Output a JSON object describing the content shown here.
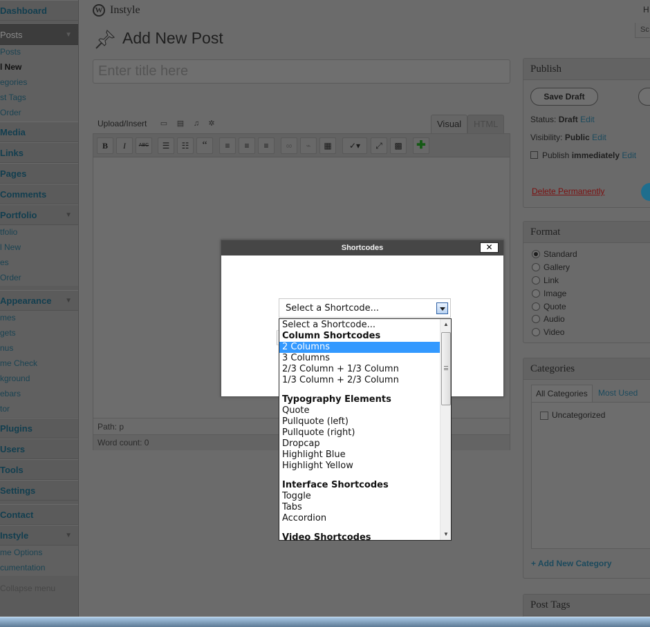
{
  "header": {
    "site_name": "Instyle",
    "howdy": "H",
    "screen_options": "Sc",
    "page_title": "Add New Post"
  },
  "sidebar": {
    "menus": [
      {
        "label": "Dashboard"
      },
      {
        "label": "Posts",
        "current": true
      },
      {
        "label": "Media"
      },
      {
        "label": "Links"
      },
      {
        "label": "Pages"
      },
      {
        "label": "Comments"
      },
      {
        "label": "Portfolio"
      },
      {
        "label": "Appearance"
      },
      {
        "label": "Plugins"
      },
      {
        "label": "Users"
      },
      {
        "label": "Tools"
      },
      {
        "label": "Settings"
      },
      {
        "label": "Contact"
      },
      {
        "label": "Instyle"
      }
    ],
    "posts_sub": [
      "Posts",
      "l New",
      "egories",
      "st Tags",
      "Order"
    ],
    "portfolio_sub": [
      "tfolio",
      "l New",
      "es",
      "Order"
    ],
    "appearance_sub": [
      "mes",
      "gets",
      "nus",
      "me Check",
      "kground",
      "ebars",
      "tor"
    ],
    "instyle_sub": [
      "me Options",
      "cumentation"
    ],
    "collapse": "Collapse menu"
  },
  "editor": {
    "title_placeholder": "Enter title here",
    "upload_label": "Upload/Insert",
    "tab_visual": "Visual",
    "tab_html": "HTML",
    "toolbar": {
      "bold": "B",
      "italic": "I",
      "strike": "ABC",
      "quote": "“"
    },
    "path": "Path: p",
    "word_count": "Word count: 0"
  },
  "publish": {
    "title": "Publish",
    "save_draft": "Save Draft",
    "status_label": "Status:",
    "status_value": "Draft",
    "visibility_label": "Visibility:",
    "visibility_value": "Public",
    "publish_label": "Publish",
    "publish_value": "immediately",
    "edit": "Edit",
    "delete": "Delete Permanently"
  },
  "format": {
    "title": "Format",
    "options": [
      "Standard",
      "Gallery",
      "Link",
      "Image",
      "Quote",
      "Audio",
      "Video"
    ],
    "selected": "Standard"
  },
  "categories": {
    "title": "Categories",
    "tab_all": "All Categories",
    "tab_used": "Most Used",
    "items": [
      "Uncategorized"
    ],
    "add_new": "+ Add New Category"
  },
  "post_tags": {
    "title": "Post Tags"
  },
  "modal": {
    "title": "Shortcodes",
    "close": "✕",
    "select_value": "Select a Shortcode...",
    "options": [
      {
        "label": "Select a Shortcode...",
        "type": "option"
      },
      {
        "label": "Column Shortcodes",
        "type": "group"
      },
      {
        "label": "2 Columns",
        "type": "option",
        "selected": true
      },
      {
        "label": "3 Columns",
        "type": "option"
      },
      {
        "label": "2/3 Column + 1/3 Column",
        "type": "option"
      },
      {
        "label": "1/3 Column + 2/3 Column",
        "type": "option"
      },
      {
        "label": "Typography Elements",
        "type": "group"
      },
      {
        "label": "Quote",
        "type": "option"
      },
      {
        "label": "Pullquote (left)",
        "type": "option"
      },
      {
        "label": "Pullquote (right)",
        "type": "option"
      },
      {
        "label": "Dropcap",
        "type": "option"
      },
      {
        "label": "Highlight Blue",
        "type": "option"
      },
      {
        "label": "Highlight Yellow",
        "type": "option"
      },
      {
        "label": "Interface Shortcodes",
        "type": "group"
      },
      {
        "label": "Toggle",
        "type": "option"
      },
      {
        "label": "Tabs",
        "type": "option"
      },
      {
        "label": "Accordion",
        "type": "option"
      },
      {
        "label": "Video Shortcodes",
        "type": "group"
      }
    ]
  }
}
